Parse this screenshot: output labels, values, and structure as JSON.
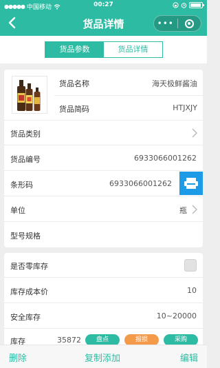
{
  "status": {
    "carrier": "中国移动",
    "time": "00:27"
  },
  "nav": {
    "title": "货品详情",
    "more": "•••"
  },
  "tabs": [
    "货品参数",
    "货品详情"
  ],
  "product": {
    "name_label": "货品名称",
    "name_value": "海天极鲜酱油",
    "abbr_label": "货品简码",
    "abbr_value": "HTJXJY"
  },
  "fields": {
    "category_label": "货品类别",
    "code_label": "货品编号",
    "code_value": "6933066001262",
    "barcode_label": "条形码",
    "barcode_value": "6933066001262",
    "unit_label": "单位",
    "unit_value": "瓶",
    "spec_label": "型号规格"
  },
  "stock": {
    "zero_label": "是否零库存",
    "cost_label": "库存成本价",
    "cost_value": "10",
    "safe_label": "安全库存",
    "safe_value": "10~20000",
    "stock_label": "库存",
    "stock_value": "35872",
    "btn_check": "盘点",
    "btn_loss": "报损",
    "btn_purchase": "采购"
  },
  "bottom": {
    "delete": "删除",
    "copy_add": "复制添加",
    "edit": "编辑"
  },
  "colors": {
    "primary": "#2dbca3",
    "scan": "#1e9be6",
    "loss": "#f39a4b"
  }
}
